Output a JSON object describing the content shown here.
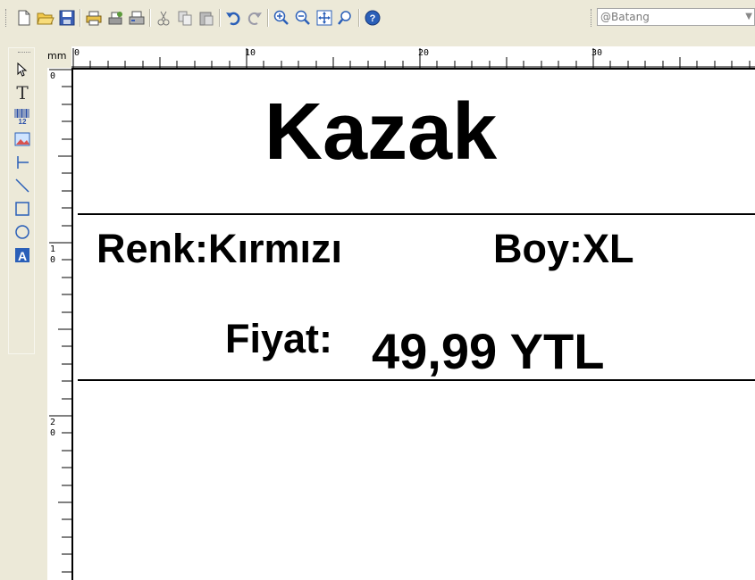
{
  "toolbar": {
    "font_name": "@Batang",
    "buttons": [
      "new-icon",
      "open-icon",
      "save-icon",
      "print-setup-icon",
      "printer-setup-icon",
      "print-icon",
      "cut-icon",
      "copy-icon",
      "paste-icon",
      "undo-icon",
      "redo-icon",
      "zoom-in-icon",
      "zoom-out-icon",
      "fit-icon",
      "zoom-select-icon",
      "help-icon"
    ]
  },
  "palette": {
    "tools": [
      "pointer-icon",
      "text-tool-icon",
      "barcode-tool-icon",
      "image-tool-icon",
      "vertical-line-icon",
      "diagonal-line-icon",
      "rectangle-icon",
      "ellipse-icon",
      "shape-tool-icon"
    ],
    "text_glyph": "T"
  },
  "ruler": {
    "unit": "mm",
    "h_labels": [
      "0",
      "10",
      "20",
      "30"
    ],
    "v_labels": [
      [
        "0"
      ],
      [
        "1",
        "0"
      ],
      [
        "2",
        "0"
      ]
    ]
  },
  "label": {
    "title": "Kazak",
    "color_text": "Renk:Kırmızı",
    "size_text": "Boy:XL",
    "price_label": "Fiyat:",
    "price_value": "49,99 YTL"
  },
  "colors": {
    "chrome": "#ece9d8",
    "icon_blue": "#2a5fb8",
    "icon_yellow": "#e8b83a"
  }
}
